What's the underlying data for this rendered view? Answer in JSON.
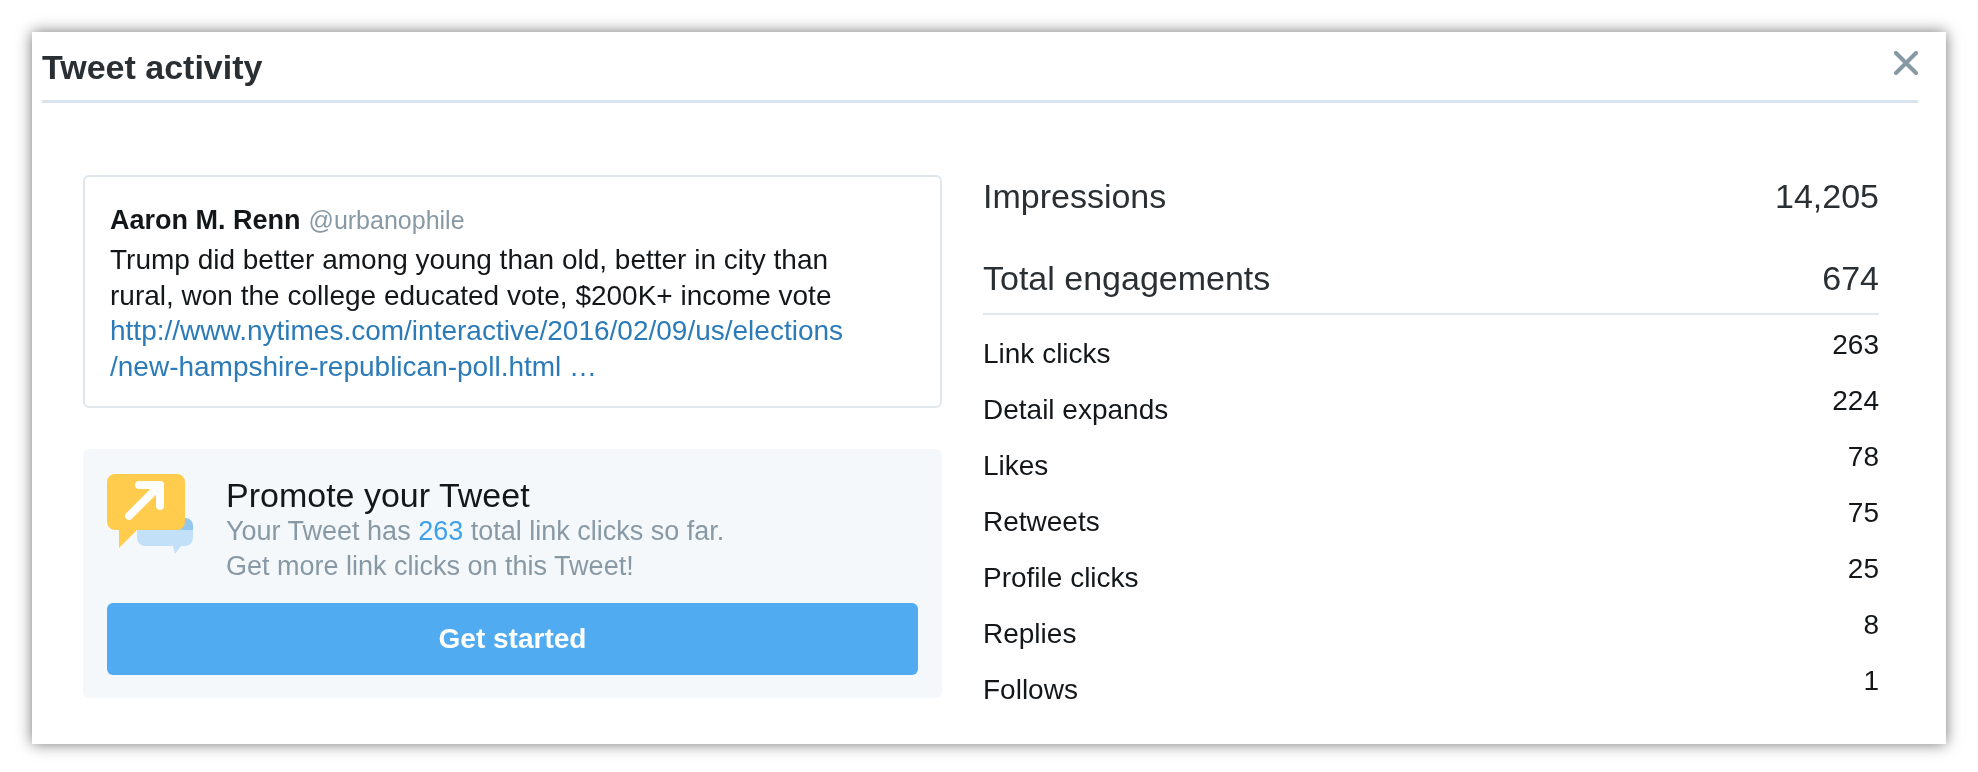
{
  "dialog": {
    "title": "Tweet activity"
  },
  "tweet": {
    "author": "Aaron M. Renn",
    "handle": "@urbanophile",
    "text_lines": [
      "Trump did better among young than old, better in city than",
      "rural, won the college educated vote, $200K+ income vote"
    ],
    "link_lines": [
      "http://www.nytimes.com/interactive/2016/02/09/us/elections",
      "/new-hampshire-republican-poll.html …"
    ]
  },
  "promote": {
    "title": "Promote your Tweet",
    "message_before": "Your Tweet has",
    "count": "263",
    "message_after": "total link clicks so far.",
    "message_line_2": "Get more link clicks on this Tweet!",
    "button": "Get started"
  },
  "summary": [
    {
      "label": "Impressions",
      "value": "14,205"
    },
    {
      "label": "Total engagements",
      "value": "674"
    }
  ],
  "breakdown": [
    {
      "label": "Link clicks",
      "value": "263"
    },
    {
      "label": "Detail expands",
      "value": "224"
    },
    {
      "label": "Likes",
      "value": "78"
    },
    {
      "label": "Retweets",
      "value": "75"
    },
    {
      "label": "Profile clicks",
      "value": "25"
    },
    {
      "label": "Replies",
      "value": "8"
    },
    {
      "label": "Follows",
      "value": "1"
    }
  ]
}
